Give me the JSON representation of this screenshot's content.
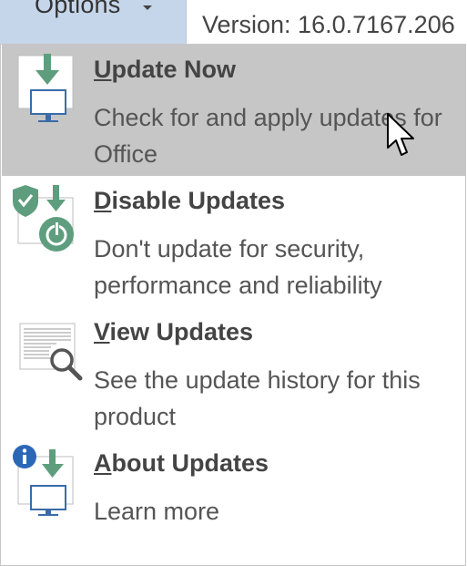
{
  "header": {
    "options_label": "Options",
    "version_text": "Version: 16.0.7167.206"
  },
  "menu": {
    "items": [
      {
        "title_accel": "U",
        "title_rest": "pdate Now",
        "desc": "Check for and apply updates for Office",
        "icon": "update-now-icon",
        "selected": true
      },
      {
        "title_accel": "D",
        "title_rest": "isable Updates",
        "desc": "Don't update for security, performance and reliability",
        "icon": "disable-updates-icon",
        "selected": false
      },
      {
        "title_accel": "V",
        "title_rest": "iew Updates",
        "desc": "See the update history for this product",
        "icon": "view-updates-icon",
        "selected": false
      },
      {
        "title_accel": "A",
        "title_rest": "bout Updates",
        "desc": "Learn more",
        "icon": "about-updates-icon",
        "selected": false
      }
    ]
  },
  "colors": {
    "options_bg": "#c5d6ea",
    "selected_bg": "#c6c6c6",
    "icon_green": "#5e9e7e",
    "icon_blue": "#3b6ba8",
    "info_blue": "#2c67b7"
  }
}
